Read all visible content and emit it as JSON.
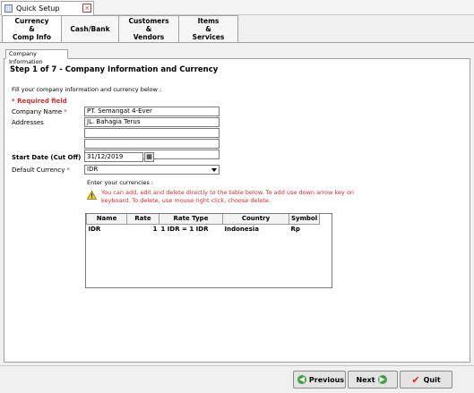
{
  "window": {
    "title": "Quick Setup",
    "close_glyph": "×"
  },
  "top_tabs": [
    {
      "label": "Currency\n&\nComp Info",
      "active": true
    },
    {
      "label": "Cash/Bank",
      "active": false
    },
    {
      "label": "Customers\n&\nVendors",
      "active": false
    },
    {
      "label": "Items\n&\nServices",
      "active": false
    }
  ],
  "sub_tab": {
    "label": "Company Information"
  },
  "step": {
    "title": "Step 1 of 7   - Company Information and Currency"
  },
  "intro": "Fill your company information and currency below :",
  "required_note": "* Required field",
  "form": {
    "company_name_label": "Company Name",
    "company_name_value": "PT. Semangat 4-Ever",
    "addresses_label": "Addresses",
    "address_1": "JL. Bahagia Terus",
    "address_2": "",
    "address_3": "",
    "address_4": "",
    "start_date_label": "Start Date (Cut Off)",
    "start_date_value": "31/12/2019",
    "default_currency_label": "Default Currency",
    "default_currency_value": "IDR",
    "required_star": "*"
  },
  "currencies": {
    "label": "Enter your currencies :",
    "warning": "You can add, edit and delete directly to the table below. To add use down arrow key on keyboard. To delete, use mouse right click, choose delete.",
    "columns": [
      "Name",
      "Rate",
      "Rate Type",
      "Country",
      "Symbol"
    ],
    "rows": [
      {
        "name": "IDR",
        "rate": "1",
        "rate_type": "1 IDR = 1 IDR",
        "country": "Indonesia",
        "symbol": "Rp"
      }
    ]
  },
  "buttons": {
    "previous": "Previous",
    "next": "Next",
    "quit": "Quit"
  },
  "colors": {
    "required_red": "#e0262b",
    "button_green": "#3ea33e"
  }
}
